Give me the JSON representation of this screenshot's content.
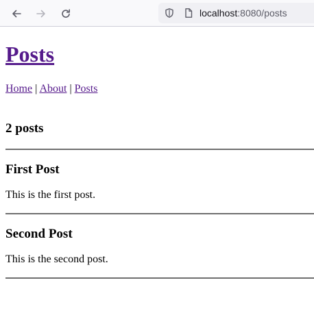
{
  "browser": {
    "url_host": "localhost",
    "url_rest": ":8080/posts"
  },
  "page": {
    "title": "Posts",
    "nav": [
      {
        "label": "Home"
      },
      {
        "label": "About"
      },
      {
        "label": "Posts"
      }
    ],
    "separator": "|",
    "count_text": "2 posts",
    "posts": [
      {
        "title": "First Post",
        "body": "This is the first post."
      },
      {
        "title": "Second Post",
        "body": "This is the second post."
      }
    ]
  },
  "colors": {
    "link": "#551a8b",
    "toolbar_bg": "#f9f9fb",
    "urlbar_bg": "#f0f0f4"
  }
}
